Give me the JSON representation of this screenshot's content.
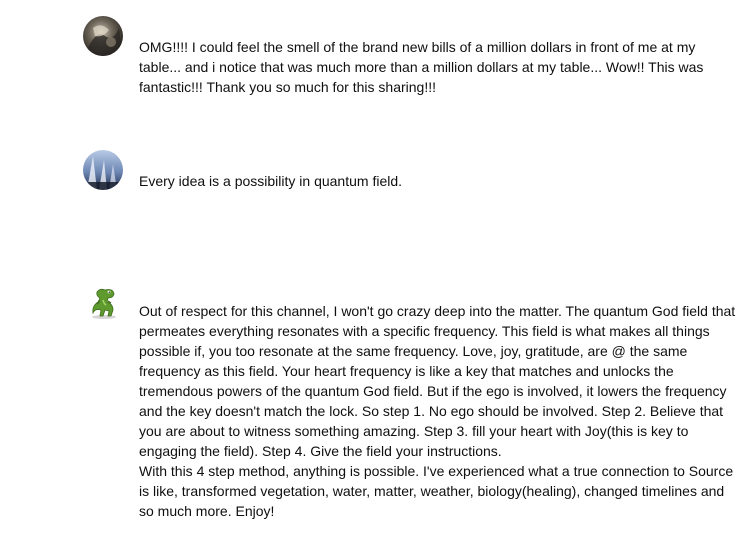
{
  "comments": [
    {
      "avatar_icon": "avatar-photo-icon",
      "text": "OMG!!!! I could  feel the smell  of the brand new bills of a million dollars in front of me at my table... and i notice that was much more than a million dollars at my table... Wow!! This was fantastic!!! Thank you so much for this sharing!!!"
    },
    {
      "avatar_icon": "avatar-photo-icon",
      "text": "Every idea is a possibility in quantum field."
    },
    {
      "avatar_icon": "dinosaur-avatar-icon",
      "text": "Out of respect for this channel, I won't go crazy deep into the matter. The quantum God field that permeates everything resonates with a specific frequency. This field is what makes all things possible if, you too resonate at the same frequency. Love, joy, gratitude, are @ the same frequency as this field. Your heart frequency is like a key that matches and unlocks the tremendous powers of the quantum God field. But if the ego is involved, it lowers the frequency and the key doesn't match the lock. So step 1. No ego should be involved. Step 2. Believe that you are about to witness something amazing. Step 3. fill your heart with Joy(this is key to engaging the field). Step 4. Give the field your instructions.\nWith this 4 step method, anything is possible. I've experienced what a true connection to Source is like, transformed vegetation, water, matter, weather, biology(healing), changed timelines and so much more. Enjoy!"
    }
  ]
}
